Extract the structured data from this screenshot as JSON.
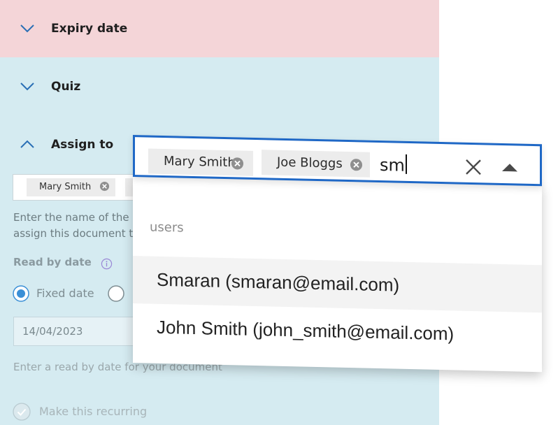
{
  "sections": {
    "expiry": {
      "title": "Expiry date",
      "expanded": false
    },
    "quiz": {
      "title": "Quiz",
      "expanded": false
    },
    "assign": {
      "title": "Assign to",
      "expanded": true
    }
  },
  "assign_field": {
    "chips": [
      "Mary Smith"
    ],
    "help_line1": "Enter the name of the",
    "help_line2": "assign this document t"
  },
  "read_by": {
    "label": "Read by date",
    "radio_fixed": "Fixed date",
    "date_value": "14/04/2023",
    "help": "Enter a read by date for your document",
    "recurring": "Make this recurring"
  },
  "popup": {
    "chips": [
      "Mary Smith",
      "Joe Bloggs"
    ],
    "typed": "sm",
    "group_label": "users",
    "options": [
      {
        "label": "Smaran (smaran@email.com)",
        "highlighted": true
      },
      {
        "label": "John Smith (john_smith@email.com)",
        "highlighted": false
      }
    ]
  },
  "colors": {
    "panel_bg": "#d5ebf1",
    "expiry_bg": "#f4d5d8",
    "accent": "#1f68c6",
    "radio_accent": "#3a8fd6"
  },
  "icons": [
    "chevron-down-icon",
    "chevron-up-icon",
    "remove-chip-icon",
    "info-icon",
    "clear-icon",
    "caret-up-icon",
    "check-circle-icon"
  ]
}
